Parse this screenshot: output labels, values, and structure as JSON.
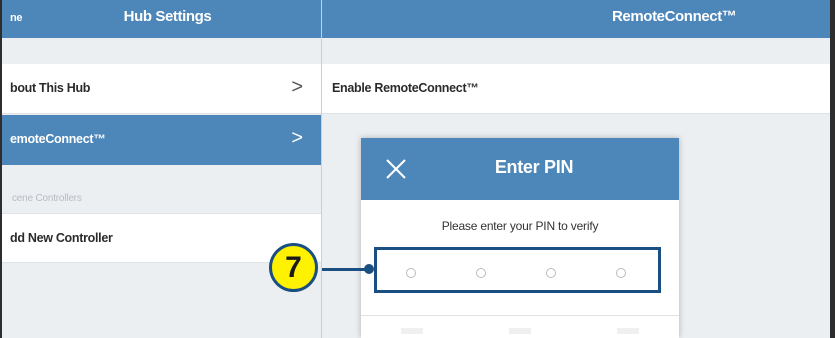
{
  "master": {
    "back_label": "ne",
    "title": "Hub Settings",
    "rows": [
      {
        "label": "bout This Hub",
        "chevron": ">"
      },
      {
        "label": "emoteConnect™",
        "chevron": ">"
      }
    ],
    "section_header": "cene Controllers",
    "add_row": {
      "label": "dd New Controller"
    }
  },
  "detail": {
    "title": "RemoteConnect™",
    "row_label": "Enable RemoteConnect™"
  },
  "dialog": {
    "title": "Enter PIN",
    "close_icon": "close-x-icon",
    "message": "Please enter your PIN to verify",
    "pin_length": 4
  },
  "callout": {
    "number": "7",
    "color": "#1b4f82",
    "badge_color": "#fff200"
  },
  "colors": {
    "accent": "#4d86b8",
    "background": "#eceff2"
  }
}
